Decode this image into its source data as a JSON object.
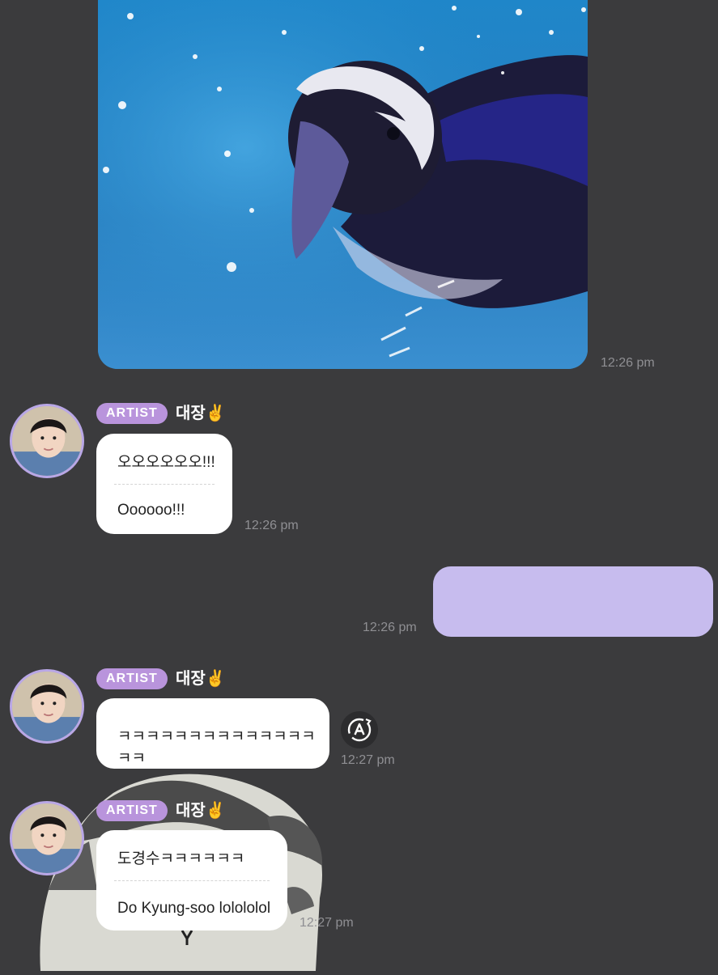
{
  "messages": {
    "photo_time": "12:26 pm",
    "msg1": {
      "badge": "ARTIST",
      "name": "대장✌️",
      "original": "오오오오오오!!!",
      "translation": "Oooooo!!!",
      "time": "12:26 pm"
    },
    "my_msg": {
      "time": "12:26 pm"
    },
    "msg2": {
      "badge": "ARTIST",
      "name": "대장✌️",
      "text": "ㅋㅋㅋㅋㅋㅋㅋㅋㅋㅋㅋㅋㅋㅋㅋㅋ",
      "time": "12:27 pm"
    },
    "msg3": {
      "badge": "ARTIST",
      "name": "대장✌️",
      "original": "도경수ㅋㅋㅋㅋㅋㅋ",
      "translation": "Do Kyung-soo lolololol",
      "time": "12:27 pm"
    }
  },
  "icons": {
    "translate": "translate-icon"
  },
  "colors": {
    "background": "#3b3b3d",
    "artist_badge": "#b994dc",
    "avatar_ring": "#b9a7e6",
    "my_bubble": "#c7bcee",
    "bubble": "#ffffff",
    "time": "#8f8f93"
  }
}
